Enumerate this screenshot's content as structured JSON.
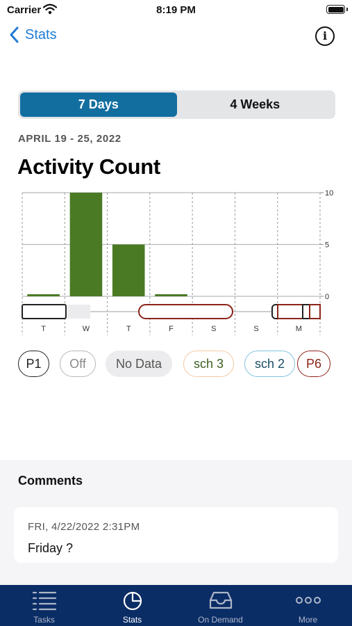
{
  "status_bar": {
    "carrier": "Carrier",
    "time": "8:19 PM"
  },
  "nav": {
    "back_label": "Stats"
  },
  "segmented": {
    "options": [
      "7 Days",
      "4 Weeks"
    ],
    "selected": 0
  },
  "date_range": "APRIL 19 - 25, 2022",
  "title": "Activity Count",
  "chart_data": {
    "type": "bar",
    "title": "Activity Count",
    "categories": [
      "T",
      "W",
      "T",
      "F",
      "S",
      "S",
      "M"
    ],
    "values": [
      0.2,
      10,
      5,
      0.2,
      0,
      0,
      0
    ],
    "ylim": [
      0,
      10
    ],
    "yticks": [
      "10",
      "5",
      "0"
    ],
    "ytick_values": [
      10,
      5,
      0
    ],
    "grid": true,
    "bar_color": "#4a7a23"
  },
  "legend": {
    "items": [
      {
        "label": "P1",
        "border": "#222222",
        "bg": "#ffffff",
        "text": "#222222"
      },
      {
        "label": "Off",
        "border": "#b8b8b8",
        "bg": "#ffffff",
        "text": "#8a8a8a"
      },
      {
        "label": "No Data",
        "border": "#ececee",
        "bg": "#ececee",
        "text": "#555555"
      },
      {
        "label": "sch 3",
        "border": "#f3c9a3",
        "bg": "#ffffff",
        "text": "#3d5f22"
      },
      {
        "label": "sch 2",
        "border": "#7fc3e0",
        "bg": "#ffffff",
        "text": "#1a4e66"
      },
      {
        "label": "P6",
        "border": "#8b2318",
        "bg": "#ffffff",
        "text": "#8b2318"
      }
    ]
  },
  "comments": {
    "title": "Comments",
    "items": [
      {
        "date": "FRI, 4/22/2022 2:31PM",
        "text": "Friday ?"
      }
    ]
  },
  "tab_bar": {
    "tabs": [
      {
        "label": "Tasks",
        "icon": "list-icon"
      },
      {
        "label": "Stats",
        "icon": "pie-chart-icon"
      },
      {
        "label": "On Demand",
        "icon": "inbox-icon"
      },
      {
        "label": "More",
        "icon": "more-dots-icon"
      }
    ],
    "selected": 1
  },
  "colors": {
    "accent": "#1f7bd6",
    "segment_active": "#136ea0",
    "tab_bar": "#0b2d66",
    "bar": "#4a7a23",
    "p6": "#8b2318"
  }
}
